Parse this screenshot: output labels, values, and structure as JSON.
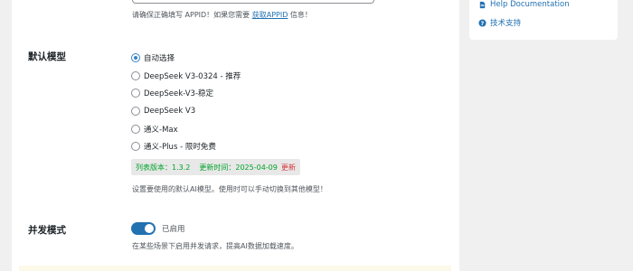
{
  "appid_hint": {
    "text": "请确保正确填写 APPID！如果您需要",
    "link": "获取APPID",
    "suffix": "信息！"
  },
  "default_model": {
    "label": "默认模型",
    "options": [
      {
        "label": "自动选择",
        "checked": true
      },
      {
        "label": "DeepSeek V3-0324 - 推荐",
        "checked": false
      },
      {
        "label": "DeepSeek-V3-稳定",
        "checked": false
      },
      {
        "label": "DeepSeek V3",
        "checked": false
      },
      {
        "label": "通义-Max",
        "checked": false
      },
      {
        "label": "通义-Plus - 限时免费",
        "checked": false
      }
    ],
    "version_label": "列表版本：1.3.2",
    "update_label": "更新时间：2025-04-09",
    "update_link": "更新",
    "hint": "设置要使用的默认AI模型。使用时可以手动切换到其他模型！"
  },
  "concurrent": {
    "label": "并发模式",
    "enabled": true,
    "status": "已启用",
    "hint": "在某些场景下启用并发请求，提高AI数据加载速度。"
  },
  "sidebar": {
    "links": [
      {
        "label": "Help Documentation",
        "icon": "document-icon"
      },
      {
        "label": "技术支持",
        "icon": "help-circle-icon"
      }
    ]
  },
  "colors": {
    "accent": "#2271b1",
    "success": "#00a32a",
    "danger": "#d63638"
  }
}
